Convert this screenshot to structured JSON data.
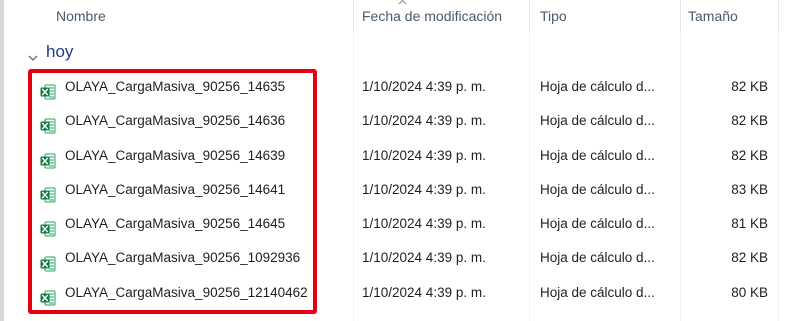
{
  "columns": {
    "name": "Nombre",
    "modified": "Fecha de modificación",
    "type": "Tipo",
    "size": "Tamaño"
  },
  "group": {
    "label": "hoy"
  },
  "files": [
    {
      "name": "OLAYA_CargaMasiva_90256_14635",
      "modified": "1/10/2024 4:39 p. m.",
      "type": "Hoja de cálculo d...",
      "size": "82 KB"
    },
    {
      "name": "OLAYA_CargaMasiva_90256_14636",
      "modified": "1/10/2024 4:39 p. m.",
      "type": "Hoja de cálculo d...",
      "size": "82 KB"
    },
    {
      "name": "OLAYA_CargaMasiva_90256_14639",
      "modified": "1/10/2024 4:39 p. m.",
      "type": "Hoja de cálculo d...",
      "size": "82 KB"
    },
    {
      "name": "OLAYA_CargaMasiva_90256_14641",
      "modified": "1/10/2024 4:39 p. m.",
      "type": "Hoja de cálculo d...",
      "size": "83 KB"
    },
    {
      "name": "OLAYA_CargaMasiva_90256_14645",
      "modified": "1/10/2024 4:39 p. m.",
      "type": "Hoja de cálculo d...",
      "size": "81 KB"
    },
    {
      "name": "OLAYA_CargaMasiva_90256_1092936",
      "modified": "1/10/2024 4:39 p. m.",
      "type": "Hoja de cálculo d...",
      "size": "82 KB"
    },
    {
      "name": "OLAYA_CargaMasiva_90256_12140462",
      "modified": "1/10/2024 4:39 p. m.",
      "type": "Hoja de cálculo d...",
      "size": "80 KB"
    }
  ],
  "icons": {
    "file": "excel-file-icon",
    "group": "chevron-down-icon",
    "sort": "sort-caret-icon"
  },
  "colors": {
    "highlight": "#e3000f",
    "excel_green": "#1d6f42",
    "group_label": "#1e3a8a"
  }
}
